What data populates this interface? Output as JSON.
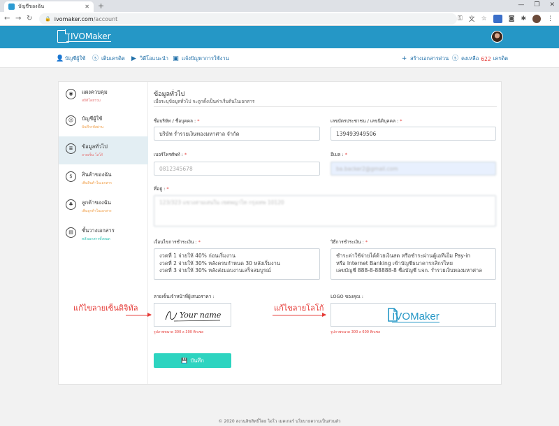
{
  "browser": {
    "tab_title": "บัญชีของฉัน",
    "url_domain": "ivomaker.com",
    "url_path": "/account"
  },
  "app": {
    "logo_prefix": "IVO",
    "logo_suffix": "Maker"
  },
  "subnav": {
    "account": "บัญชีผู้ใช้",
    "topup": "เติมเครดิต",
    "video": "วิดีโอแนะนำ",
    "report": "แจ้งปัญหาการใช้งาน",
    "create_doc": "สร้างเอกสารด่วน",
    "credit_prefix": "คงเหลือ",
    "credit_value": "622",
    "credit_unit": "เครดิต"
  },
  "sidebar": {
    "items": [
      {
        "title": "แผงควบคุม",
        "sub": "สถิติโดยรวม"
      },
      {
        "title": "บัญชีผู้ใช้",
        "sub": "บันทึกรหัสผ่าน"
      },
      {
        "title": "ข้อมูลทั่วไป",
        "sub": "ลายเซ็น โลโก้"
      },
      {
        "title": "สินค้าของฉัน",
        "sub": "เพิ่มสินค้าในเอกสาร"
      },
      {
        "title": "ลูกค้าของฉัน",
        "sub": "เพิ่มลูกค้าในเอกสาร"
      },
      {
        "title": "ชั้นวางเอกสาร",
        "sub": "คลังเอกสารทั้งหมด"
      }
    ]
  },
  "form": {
    "title": "ข้อมูลทั่วไป",
    "subtitle": "เมื่อระบุข้อมูลทั่วไป จะถูกตั้งเป็นค่าเริ่มต้นในเอกสาร",
    "company_label": "ชื่อบริษัท / ชื่อบุคคล :",
    "company_value": "บริษัท ร่ำรวยเงินทองมหาศาล จำกัด",
    "taxid_label": "เลขบัตรประชาชน / เลขนิติบุคคล :",
    "taxid_value": "139493949506",
    "phone_label": "เบอร์โทรศัพท์ :",
    "phone_placeholder": "0812345678",
    "email_label": "อีเมล :",
    "email_value": "ba.backer2@gmail.com",
    "address_label": "ที่อยู่ :",
    "address_value": "123/323 แขวงสามเสนใน เขตพญาไท กรุงเทพ 10120",
    "terms_label": "เงื่อนไขการชำระเงิน :",
    "terms_lines": [
      "งวดที่ 1 จ่ายให้ 40% ก่อนเริ่มงาน",
      "งวดที่ 2 จ่ายให้ 30% หลังครบกำหนด 30 หลังเริ่มงาน",
      "งวดที่ 3 จ่ายให้ 30% หลังส่งมอบงานเสร็จสมบูรณ์"
    ],
    "method_label": "วิธีการชำระเงิน :",
    "method_lines": [
      "ชำระค่าใช้จ่ายได้ด้วยเงินสด หรือชำระผ่านตู้เอทีเอ็ม Pay-in",
      "หรือ Internet Banking เข้าบัญชีธนาคารกสิกรไทย",
      "เลขบัญชี 888-8-88888-8 ชื่อบัญชี บจก. ร่ำรวยเงินทองมหาศาล"
    ],
    "signature_label": "ลายเซ็นเจ้าหน้าที่ผู้เสนอราคา :",
    "signature_text": "Your name",
    "signature_hint": "รูปภาพขนาด 300 x 300 พิกเซล",
    "logo_label": "LOGO ของคุณ :",
    "logo_hint": "รูปภาพขนาด 300 x 600 พิกเซล",
    "save_label": "บันทึก"
  },
  "annotations": {
    "edit_signature": "แก้ไขลายเซ็นดิจิทัล",
    "edit_logo": "แก้ไขลายโลโก้"
  },
  "footer": "© 2020 สงวนลิขสิทธิ์โดย ไอโว เมคเกอร์ นโยบายความเป็นส่วนตัว"
}
